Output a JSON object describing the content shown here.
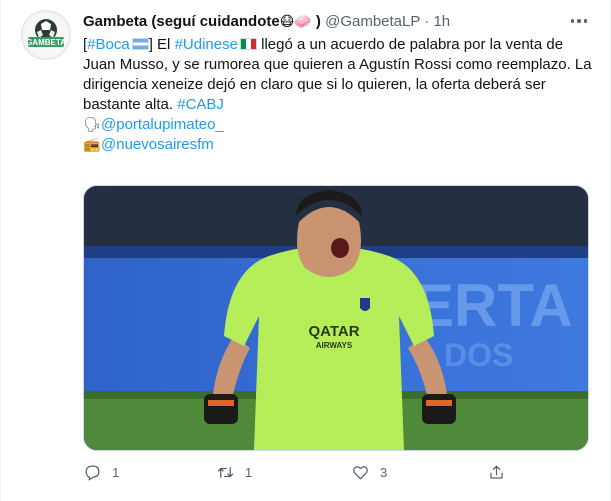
{
  "tweet": {
    "author": {
      "name": "Gambeta (seguí cuidandote",
      "name_emoji": "😷",
      "name_emoji2": "🧼",
      "name_end": ")",
      "handle": "@GambetaLP",
      "separator": "·",
      "time": "1h",
      "avatar_text": "GAMBETA"
    },
    "text": {
      "open_bracket": "[",
      "hashtag_boca": "#Boca",
      "close_bracket": "] El",
      "hashtag_udinese": "#Udinese",
      "body": "llegó a un acuerdo de palabra por la venta de Juan Musso, y se rumorea que quieren a Agustín Rossi como reemplazo. La dirigencia xeneize dejó en claro que si lo quieren, la oferta deberá ser bastante alta.",
      "hashtag_cabj": "#CABJ"
    },
    "mentions": [
      {
        "icon": "speaking-head-icon",
        "glyph": "🗣",
        "handle": "@portalupimateo_"
      },
      {
        "icon": "radio-icon",
        "glyph": "📻",
        "handle": "@nuevosairesfm"
      }
    ],
    "media": {
      "sponsor": "QATAR",
      "sponsor_sub": "AIRWAYS",
      "background_text": "ERTA",
      "background_sub": "DOS"
    },
    "actions": {
      "reply_count": "1",
      "retweet_count": "1",
      "like_count": "3",
      "share_label": ""
    }
  },
  "colors": {
    "accent": "#1d9bf0",
    "text": "#0f1419",
    "muted": "#536471",
    "kit_green": "#b6ee5a"
  }
}
